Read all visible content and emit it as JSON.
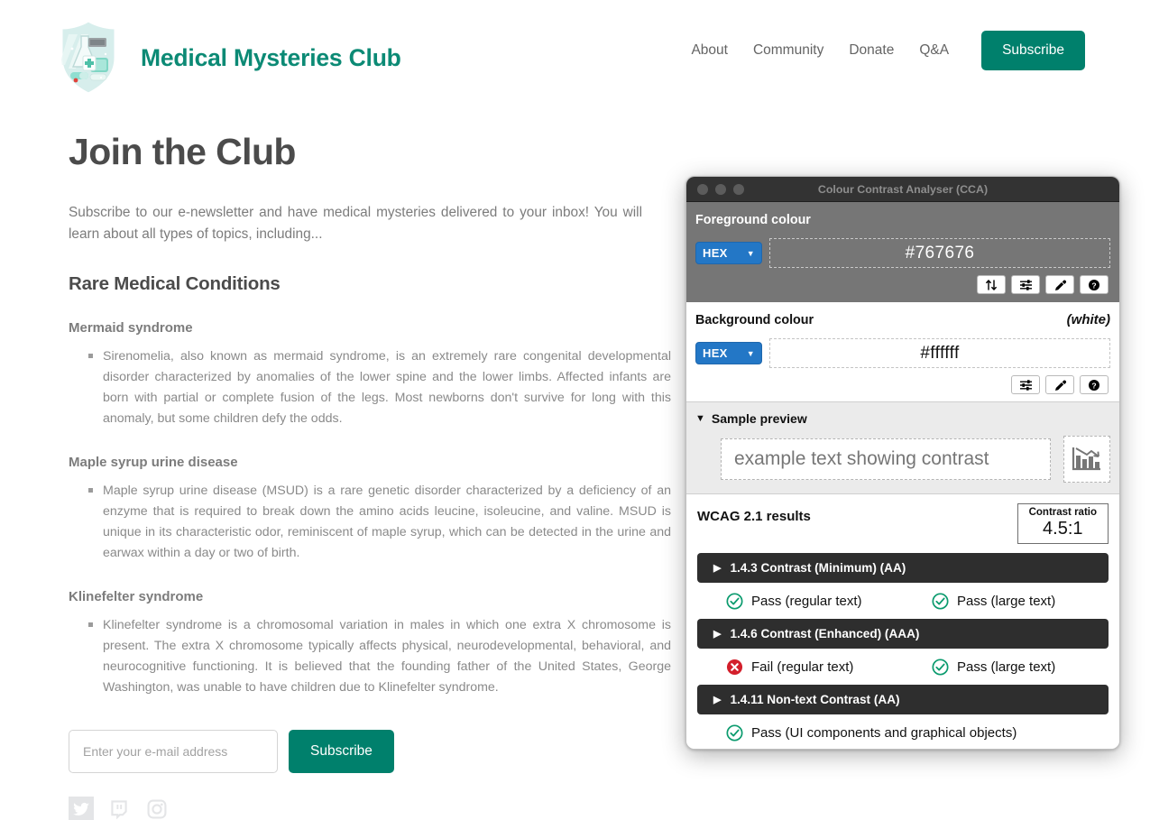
{
  "site": {
    "brand_name": "Medical Mysteries Club",
    "brand_color": "#0c8a75",
    "logo_icon": "medical-shield-logo",
    "nav": {
      "links": [
        {
          "label": "About"
        },
        {
          "label": "Community"
        },
        {
          "label": "Donate"
        },
        {
          "label": "Q&A"
        }
      ],
      "subscribe_label": "Subscribe"
    }
  },
  "main": {
    "page_title": "Join the Club",
    "intro": "Subscribe to our e-newsletter and have medical mysteries delivered to your inbox! You will learn about all types of topics, including...",
    "section_title": "Rare Medical Conditions",
    "conditions": [
      {
        "title": "Mermaid syndrome",
        "body": "Sirenomelia, also known as mermaid syndrome, is an extremely rare congenital developmental disorder characterized by anomalies of the lower spine and the lower limbs. Affected infants are born with partial or complete fusion of the legs. Most newborns don't survive for long with this anomaly, but some children defy the odds."
      },
      {
        "title": "Maple syrup urine disease",
        "body": "Maple syrup urine disease (MSUD) is a rare genetic disorder characterized by a deficiency of an enzyme that is required to break down the amino acids leucine, isoleucine, and valine. MSUD is unique in its characteristic odor, reminiscent of maple syrup, which can be detected in the urine and earwax within a day or two of birth."
      },
      {
        "title": "Klinefelter syndrome",
        "body": "Klinefelter syndrome is a chromosomal variation in males in which one extra X chromosome is present. The extra X chromosome typically affects physical, neurodevelopmental, behavioral, and neurocognitive functioning. It is believed that the founding father of the United States, George Washington, was unable to have children due to Klinefelter syndrome."
      }
    ],
    "subscribe_form": {
      "email_placeholder": "Enter your e-mail address",
      "email_value": "",
      "button_label": "Subscribe"
    },
    "socials": [
      {
        "icon": "twitter-icon"
      },
      {
        "icon": "twitch-icon"
      },
      {
        "icon": "instagram-icon"
      }
    ]
  },
  "cca": {
    "window_title": "Colour Contrast Analyser (CCA)",
    "traffic_lights": [
      "close",
      "minimize",
      "maximize"
    ],
    "foreground": {
      "label": "Foreground colour",
      "format": "HEX",
      "value": "#767676",
      "swatch_color": "#767676",
      "buttons": [
        {
          "icon": "swap-colours-icon"
        },
        {
          "icon": "sliders-icon"
        },
        {
          "icon": "eyedropper-icon"
        },
        {
          "icon": "help-icon"
        }
      ]
    },
    "background": {
      "label": "Background colour",
      "note": "(white)",
      "format": "HEX",
      "value": "#ffffff",
      "swatch_color": "#ffffff",
      "buttons": [
        {
          "icon": "sliders-icon"
        },
        {
          "icon": "eyedropper-icon"
        },
        {
          "icon": "help-icon"
        }
      ]
    },
    "sample_preview": {
      "header": "Sample preview",
      "disclosure": "▼",
      "sample_text": "example text showing contrast",
      "graphic_icon": "bar-chart-declining-icon"
    },
    "wcag": {
      "title": "WCAG 2.1 results",
      "ratio_label": "Contrast ratio",
      "ratio_value": "4.5:1",
      "criteria": [
        {
          "name": "1.4.3 Contrast (Minimum) (AA)",
          "disclosure": "▶",
          "results": [
            {
              "status": "pass",
              "text": "Pass (regular text)"
            },
            {
              "status": "pass",
              "text": "Pass (large text)"
            }
          ]
        },
        {
          "name": "1.4.6 Contrast (Enhanced) (AAA)",
          "disclosure": "▶",
          "results": [
            {
              "status": "fail",
              "text": "Fail (regular text)"
            },
            {
              "status": "pass",
              "text": "Pass (large text)"
            }
          ]
        },
        {
          "name": "1.4.11 Non-text Contrast (AA)",
          "disclosure": "▶",
          "results": [
            {
              "status": "pass",
              "text": "Pass (UI components and graphical objects)"
            }
          ]
        }
      ]
    },
    "colors": {
      "pass_green": "#0b9b6e",
      "fail_red": "#d31f2b",
      "select_blue": "#2377c6",
      "criterion_bar": "#2e2e2e"
    }
  }
}
